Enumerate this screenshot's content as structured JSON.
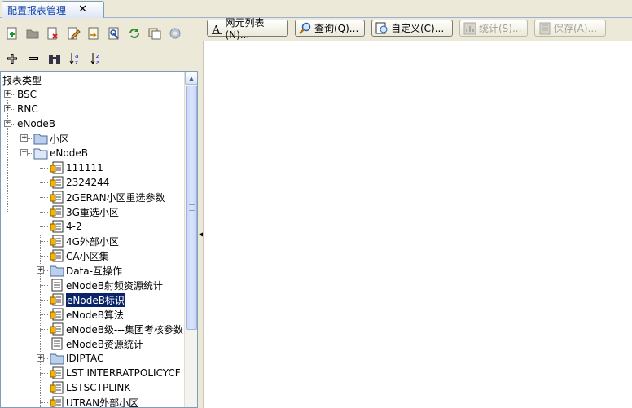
{
  "tab": {
    "title": "配置报表管理",
    "close": "✕"
  },
  "left_toolbar": {
    "row1": [
      "new-report-icon",
      "open-folder-icon",
      "delete-icon",
      "edit-icon",
      "import-icon",
      "export-icon",
      "refresh-icon",
      "copy-icon",
      "settings-icon"
    ],
    "row2": [
      "add-icon",
      "remove-icon",
      "binoculars-icon",
      "sort-ascending-icon",
      "sort-descending-icon"
    ]
  },
  "tree": {
    "root": "报表类型",
    "items": [
      {
        "label": "BSC",
        "level": 0,
        "kind": "text",
        "expander": "+"
      },
      {
        "label": "RNC",
        "level": 0,
        "kind": "text",
        "expander": "+"
      },
      {
        "label": "eNodeB",
        "level": 0,
        "kind": "text",
        "expander": "-"
      },
      {
        "label": "小区",
        "level": 1,
        "kind": "folder",
        "expander": "+"
      },
      {
        "label": "eNodeB",
        "level": 1,
        "kind": "folder-open",
        "expander": "-"
      },
      {
        "label": "111111",
        "level": 2,
        "kind": "report-lock"
      },
      {
        "label": "2324244",
        "level": 2,
        "kind": "report-lock"
      },
      {
        "label": "2GERAN小区重选参数",
        "level": 2,
        "kind": "report-lock"
      },
      {
        "label": "3G重选小区",
        "level": 2,
        "kind": "report-lock"
      },
      {
        "label": "4-2",
        "level": 2,
        "kind": "report-lock"
      },
      {
        "label": "4G外部小区",
        "level": 2,
        "kind": "report-lock"
      },
      {
        "label": "CA小区集",
        "level": 2,
        "kind": "report-lock"
      },
      {
        "label": "Data-互操作",
        "level": 2,
        "kind": "folder",
        "expander": "+"
      },
      {
        "label": "eNodeB射频资源统计",
        "level": 2,
        "kind": "report"
      },
      {
        "label": "eNodeB标识",
        "level": 2,
        "kind": "report-lock",
        "selected": true
      },
      {
        "label": "eNodeB算法",
        "level": 2,
        "kind": "report-lock"
      },
      {
        "label": "eNodeB级---集团考核参数",
        "level": 2,
        "kind": "report-lock"
      },
      {
        "label": "eNodeB资源统计",
        "level": 2,
        "kind": "report"
      },
      {
        "label": "IDIPTAC",
        "level": 2,
        "kind": "folder",
        "expander": "+"
      },
      {
        "label": "LST INTERRATPOLICYCF",
        "level": 2,
        "kind": "report-lock"
      },
      {
        "label": "LSTSCTPLINK",
        "level": 2,
        "kind": "report-lock"
      },
      {
        "label": "UTRAN外部小区",
        "level": 2,
        "kind": "report-lock"
      }
    ]
  },
  "right_toolbar": {
    "buttons": [
      {
        "label": "网元列表(N)...",
        "icon": "font-a-icon",
        "enabled": true
      },
      {
        "label": "查询(Q)...",
        "icon": "magnifier-icon",
        "enabled": true
      },
      {
        "label": "自定义(C)...",
        "icon": "customize-icon",
        "enabled": true
      },
      {
        "label": "统计(S)...",
        "icon": "statistics-icon",
        "enabled": false
      },
      {
        "label": "保存(A)...",
        "icon": "save-icon",
        "enabled": false
      }
    ]
  },
  "colors": {
    "selection": "#0a246a",
    "tab_text": "#1646a8",
    "panel": "#ece9d8"
  }
}
